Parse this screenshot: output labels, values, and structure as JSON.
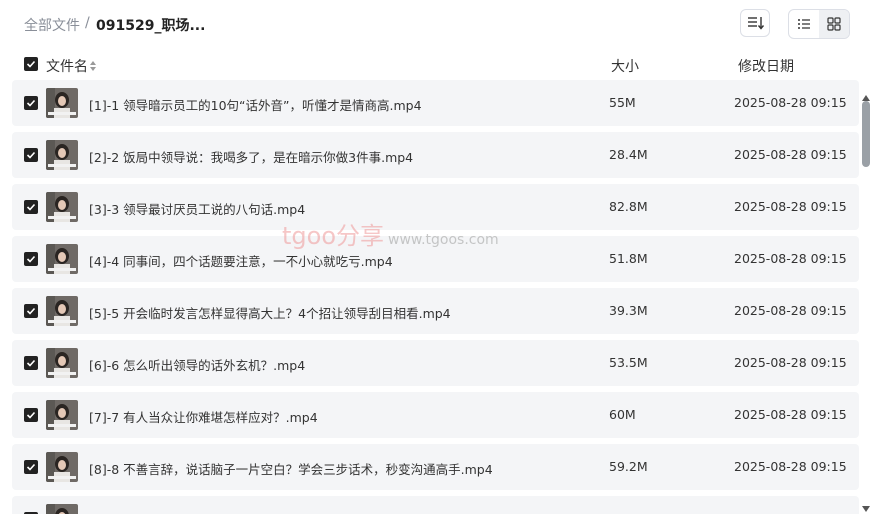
{
  "breadcrumb": {
    "root": "全部文件",
    "separator": "/",
    "current": "091529_职场..."
  },
  "header": {
    "name": "文件名",
    "size": "大小",
    "date": "修改日期"
  },
  "watermark": {
    "logo": "tgoo分享",
    "url": "www.tgoos.com"
  },
  "colors": {
    "row_bg": "#f4f5f7",
    "checkbox": "#222222",
    "scroll_thumb": "#9aa0a6"
  },
  "files": [
    {
      "name": "[1]-1 领导暗示员工的10句“话外音”，听懂才是情商高.mp4",
      "size": "55M",
      "date": "2025-08-28 09:15"
    },
    {
      "name": "[2]-2 饭局中领导说：我喝多了，是在暗示你做3件事.mp4",
      "size": "28.4M",
      "date": "2025-08-28 09:15"
    },
    {
      "name": "[3]-3 领导最讨厌员工说的八句话.mp4",
      "size": "82.8M",
      "date": "2025-08-28 09:15"
    },
    {
      "name": "[4]-4 同事间，四个话题要注意，一不小心就吃亏.mp4",
      "size": "51.8M",
      "date": "2025-08-28 09:15"
    },
    {
      "name": "[5]-5 开会临时发言怎样显得高大上？4个招让领导刮目相看.mp4",
      "size": "39.3M",
      "date": "2025-08-28 09:15"
    },
    {
      "name": "[6]-6 怎么听出领导的话外玄机？.mp4",
      "size": "53.5M",
      "date": "2025-08-28 09:15"
    },
    {
      "name": "[7]-7 有人当众让你难堪怎样应对？.mp4",
      "size": "60M",
      "date": "2025-08-28 09:15"
    },
    {
      "name": "[8]-8 不善言辞，说话脑子一片空白？学会三步话术，秒变沟通高手.mp4",
      "size": "59.2M",
      "date": "2025-08-28 09:15"
    },
    {
      "name": "",
      "size": "",
      "date": ""
    }
  ]
}
